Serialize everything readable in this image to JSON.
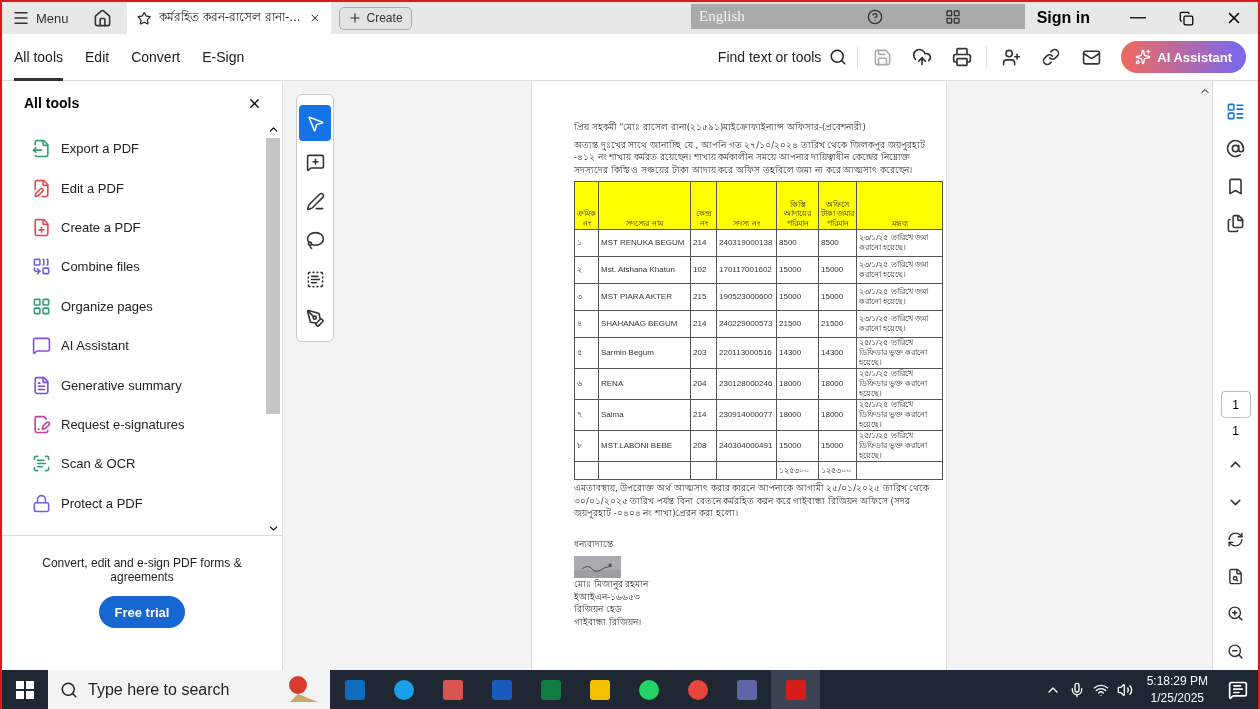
{
  "title_bar": {
    "menu": "Menu",
    "tab": {
      "title": "কর্মরহিত করন-রাসেল রানা-...",
      "selected": true
    },
    "create": "Create",
    "language": "English",
    "sign_in": "Sign in"
  },
  "tabs": [
    {
      "label": "All tools",
      "selected": true
    },
    {
      "label": "Edit",
      "selected": false
    },
    {
      "label": "Convert",
      "selected": false
    },
    {
      "label": "E-Sign",
      "selected": false
    }
  ],
  "find": "Find text or tools",
  "ai_button": "AI Assistant",
  "panel": {
    "title": "All tools",
    "items": [
      "Export a PDF",
      "Edit a PDF",
      "Create a PDF",
      "Combine files",
      "Organize pages",
      "AI Assistant",
      "Generative summary",
      "Request e-signatures",
      "Scan & OCR",
      "Protect a PDF"
    ],
    "promo": "Convert, edit and e-sign PDF forms & agreements",
    "trial": "Free trial"
  },
  "document": {
    "salutation": "প্রিয় সহকর্মী \"মোঃ রাসেল রানা(২১৫৯১)মাইক্রোফাইন্যান্স অফিসার-(প্রবেশনারী)",
    "intro": "অত্যন্ত দুঃখের সাথে জানাচ্ছি যে , আপনি গত ২৭/১০/২০২৪ তারিখ থেকে জিলকপুর জয়পুরহাট -৪১২ নং শাখায় কর্মরত রয়েছেন। শাখায় কর্মকালীন সময়ে আপনার দায়িত্বাধীন কেন্দ্রের নিম্নোক্ত সদস্যদের কিস্তি ও সঞ্চয়ের টাকা আদায় করে অফিস তহবিলে জমা না করে আত্মসাৎ করেছেন।",
    "table": {
      "columns": [
        "ক্রমিক নং",
        "সদস্যের নাম",
        "কেন্দ্র নং",
        "সদস্য নং",
        "কিস্তি আদায়ের পরিমান",
        "অফিসে টাকা জমার পরিমান",
        "মন্তব্য"
      ],
      "rows": [
        [
          "১",
          "MST  RENUKA  BEGUM",
          "214",
          "240319000138",
          "8500",
          "8500",
          "২৩/১/২৫ তারিখে জমা করানো হয়েছে।"
        ],
        [
          "২",
          "Mst.  Afshana  Khatun",
          "102",
          "170117001602",
          "15000",
          "15000",
          "২৩/১/২৫ তারিখে জমা করানো হয়েছে।"
        ],
        [
          "৩",
          "MST  PIARA  AKTER",
          "215",
          "190523000600",
          "15000",
          "15000",
          "২৩/১/২৫ তারিখে জমা করানো হয়েছে।"
        ],
        [
          "৪",
          "SHAHANAG  BEGUM",
          "214",
          "240229000573",
          "21500",
          "21500",
          "২৩/১/২৫ তারিখে জমা করানো হয়েছে।"
        ],
        [
          "৫",
          "Sarmin  Begum",
          "203",
          "220113000516",
          "14300",
          "14300",
          "২৫/১/২৫ তারিখে ডিফিডার ভুক্ত করানো হয়েছে।"
        ],
        [
          "৬",
          "RENA",
          "204",
          "230128000246",
          "18000",
          "18000",
          "২৫/১/২৫ তারিখে ডিফিডার ভুক্ত করানো হয়েছে।"
        ],
        [
          "৭",
          "Saima",
          "214",
          "230914000077",
          "18000",
          "18000",
          "২৫/১/২৫ তারিখে ডিফিডার ভুক্ত করানো হয়েছে।"
        ],
        [
          "৮",
          "MST.LABONI  BEBE",
          "208",
          "240304000491",
          "15000",
          "15000",
          "২৫/১/২৫ তারিখে ডিফিডার ভুক্ত করানো হয়েছে।"
        ]
      ],
      "totals": [
        "১২৫৩০০",
        "১২৫৩০০"
      ]
    },
    "decision": "এমতাবস্থায়, উপরোক্ত অর্থ আত্মসাৎ করার কারনে আপনাকে আগামী ২৫/০১/২০২৫ তারিখ থেকে ৩০/০১/২০২৫ তারিখ পর্যন্ত বিনা বেতনে কর্মরহিত করন করে গাইবান্ধা রিজিয়ন অফিসে (সদর জয়পুরহাট -০৪০৪ নং শাখা)প্রেরন করা হলো।",
    "closing": "ধন্যবাদান্তে",
    "signer": [
      "মোঃ মিজানুর রহমান",
      "ইআইএন-১৬৬৫৩",
      "রিজিয়ন হেড",
      "গাইবান্ধা রিজিয়ন।"
    ]
  },
  "page": {
    "current": "1",
    "total": "1"
  },
  "taskbar": {
    "search": "Type here to search",
    "time": "5:18:29 PM",
    "date": "1/25/2025"
  }
}
